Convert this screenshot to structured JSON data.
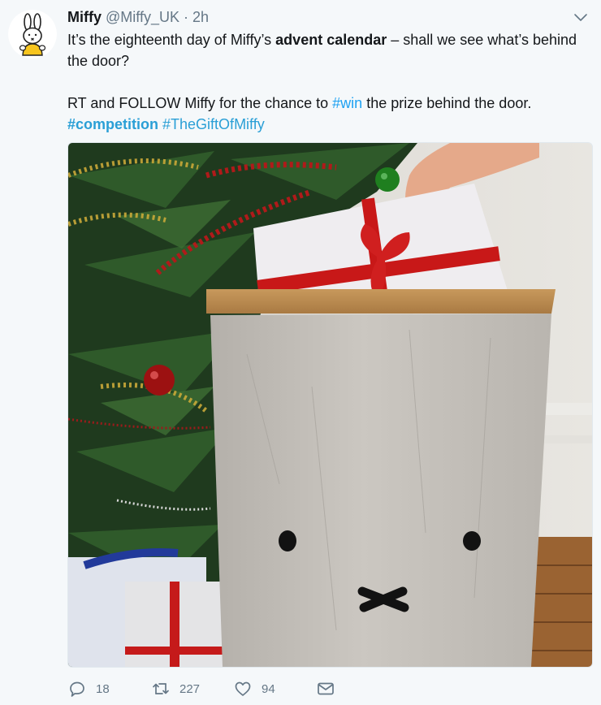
{
  "tweet": {
    "display_name": "Miffy",
    "handle": "@Miffy_UK",
    "separator": "·",
    "time": "2h",
    "line1_pre": "It’s the eighteenth day of Miffy’s ",
    "line1_bold": "advent calendar",
    "line1_post": " – shall we see what’s behind the door?",
    "line2_pre": "RT and FOLLOW Miffy for the chance to ",
    "hashtag_win": "#win",
    "line2_post": " the prize behind the door.",
    "hashtag_competition": "#competition",
    "hashtag_gift": "#TheGiftOfMiffy"
  },
  "actions": {
    "replies": "18",
    "retweets": "227",
    "likes": "94"
  },
  "icons": {
    "avatar": "miffy-avatar-icon",
    "menu": "chevron-down-icon",
    "reply": "reply-icon",
    "retweet": "retweet-icon",
    "like": "heart-icon",
    "dm": "envelope-icon"
  },
  "colors": {
    "link": "#1da1f2",
    "muted": "#657786",
    "text": "#14171a",
    "background": "#f5f8fa"
  }
}
